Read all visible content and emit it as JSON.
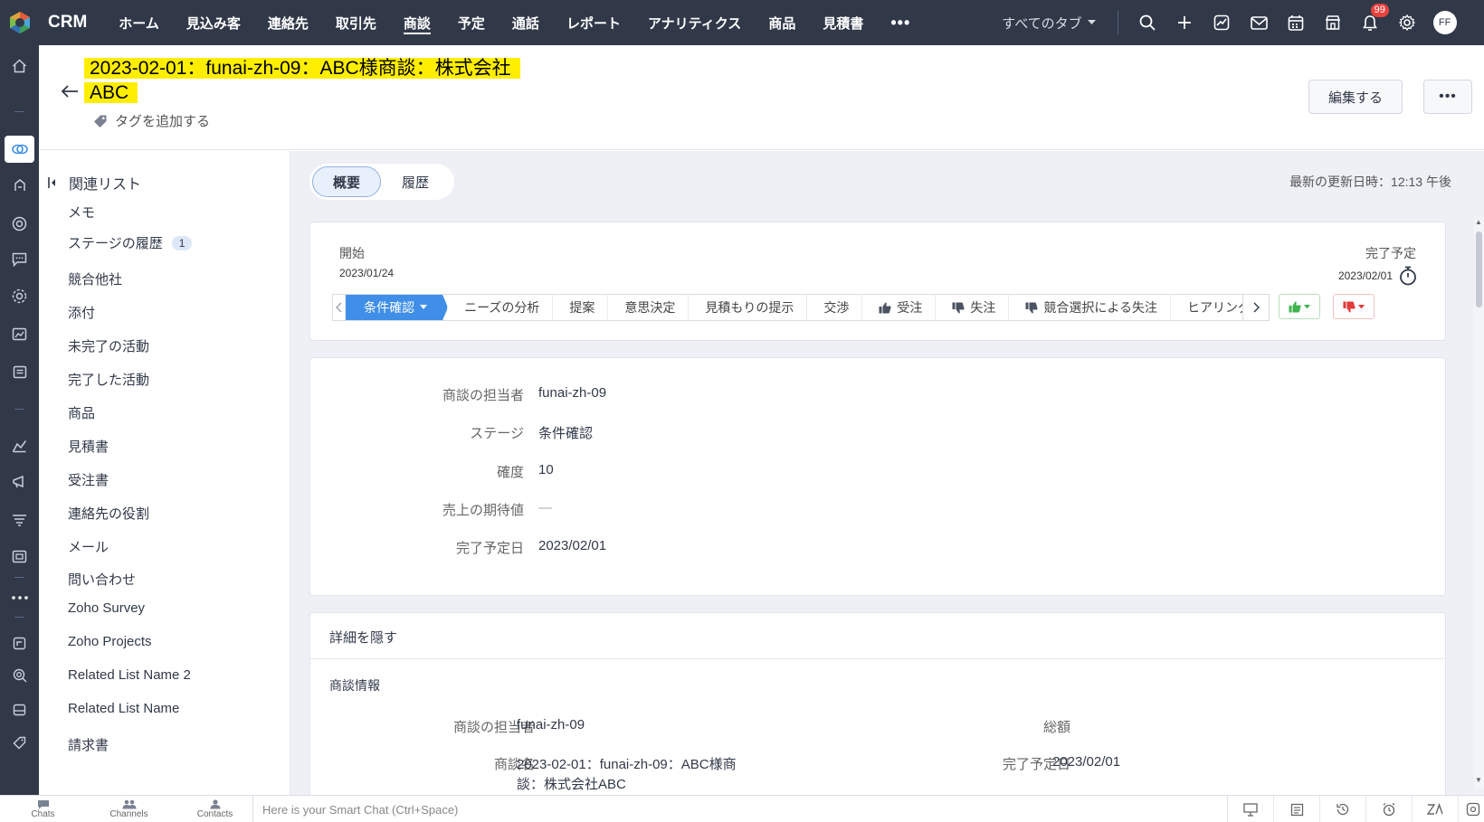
{
  "app": {
    "title": "CRM"
  },
  "nav": {
    "tabs": [
      {
        "label": "ホーム"
      },
      {
        "label": "見込み客"
      },
      {
        "label": "連絡先"
      },
      {
        "label": "取引先"
      },
      {
        "label": "商談"
      },
      {
        "label": "予定"
      },
      {
        "label": "通話"
      },
      {
        "label": "レポート"
      },
      {
        "label": "アナリティクス"
      },
      {
        "label": "商品"
      },
      {
        "label": "見積書"
      }
    ],
    "active_tab": "商談",
    "more_label": "•••",
    "all_tabs_label": "すべてのタブ",
    "notification_count": "99",
    "avatar_initials": "FF"
  },
  "record": {
    "title_line1": "2023-02-01：funai-zh-09：ABC様商談：株式会社",
    "title_line2": "ABC",
    "add_tag_label": "タグを追加する",
    "edit_button": "編集する",
    "more_button": "•••"
  },
  "related": {
    "heading": "関連リスト",
    "items": [
      {
        "label": "メモ"
      },
      {
        "label": "ステージの履歴",
        "count": "1"
      },
      {
        "label": "競合他社"
      },
      {
        "label": "添付"
      },
      {
        "label": "未完了の活動"
      },
      {
        "label": "完了した活動"
      },
      {
        "label": "商品"
      },
      {
        "label": "見積書"
      },
      {
        "label": "受注書"
      },
      {
        "label": "連絡先の役割"
      },
      {
        "label": "メール"
      },
      {
        "label": "問い合わせ"
      },
      {
        "label": "Zoho Survey"
      },
      {
        "label": "Zoho Projects"
      },
      {
        "label": "Related List Name 2"
      },
      {
        "label": "Related List Name"
      },
      {
        "label": "請求書"
      }
    ]
  },
  "view": {
    "overview_label": "概要",
    "history_label": "履歴",
    "last_updated": "最新の更新日時：12:13 午後"
  },
  "stage_card": {
    "start_label": "開始",
    "start_date": "2023/01/24",
    "due_label": "完了予定",
    "due_date": "2023/02/01",
    "stages": [
      {
        "label": "条件確認",
        "active": true
      },
      {
        "label": "ニーズの分析"
      },
      {
        "label": "提案"
      },
      {
        "label": "意思決定"
      },
      {
        "label": "見積もりの提示"
      },
      {
        "label": "交渉"
      },
      {
        "label": "受注",
        "icon": "thumbs-up"
      },
      {
        "label": "失注",
        "icon": "thumbs-down"
      },
      {
        "label": "競合選択による失注",
        "icon": "thumbs-down"
      },
      {
        "label": "ヒアリング"
      }
    ],
    "colors": {
      "active": "#3f8ee8",
      "won": "#3fb34f",
      "lost": "#e23b3b"
    }
  },
  "summary": {
    "fields": [
      {
        "label": "商談の担当者",
        "value": "funai-zh-09"
      },
      {
        "label": "ステージ",
        "value": "条件確認"
      },
      {
        "label": "確度",
        "value": "10"
      },
      {
        "label": "売上の期待値",
        "value": "—"
      },
      {
        "label": "完了予定日",
        "value": "2023/02/01"
      }
    ]
  },
  "details": {
    "toggle_label": "詳細を隠す",
    "section_title": "商談情報",
    "left": [
      {
        "label": "商談の担当者",
        "value": "funai-zh-09"
      },
      {
        "label": "商談名",
        "value": "2023-02-01：funai-zh-09：ABC様商",
        "value_line2": "談：株式会社ABC"
      }
    ],
    "right": [
      {
        "label": "総額",
        "value": "—"
      },
      {
        "label": "完了予定日",
        "value": "2023/02/01"
      }
    ]
  },
  "bottom": {
    "chats": "Chats",
    "channels": "Channels",
    "contacts": "Contacts",
    "smart_chat_placeholder": "Here is your Smart Chat (Ctrl+Space)"
  }
}
